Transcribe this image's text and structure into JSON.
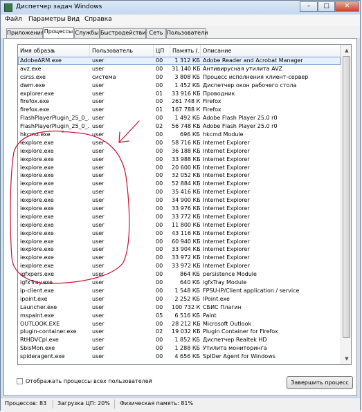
{
  "window": {
    "title": "Диспетчер задач Windows"
  },
  "window_controls": {
    "minimize": "–",
    "maximize": "□",
    "close": "✕"
  },
  "menu": [
    "Файл",
    "Параметры",
    "Вид",
    "Справка"
  ],
  "tabs": [
    "Приложения",
    "Процессы",
    "Службы",
    "Быстродействие",
    "Сеть",
    "Пользователи"
  ],
  "active_tab": "Процессы",
  "columns": [
    "Имя образа",
    "Пользователь",
    "ЦП",
    "Память (...",
    "Описание"
  ],
  "processes": [
    [
      "AdobeARM.exe",
      "user",
      "00",
      "1 312 КБ",
      "Adobe Reader and Acrobat Manager"
    ],
    [
      "avz.exe",
      "user",
      "00",
      "31 140 КБ",
      "Антивирусная утилита AVZ"
    ],
    [
      "csrss.exe",
      "система",
      "00",
      "3 808 КБ",
      "Процесс исполнения клиент-сервер"
    ],
    [
      "dwm.exe",
      "user",
      "00",
      "1 452 КБ",
      "Диспетчер окон рабочего стола"
    ],
    [
      "explorer.exe",
      "user",
      "01",
      "33 916 КБ",
      "Проводник"
    ],
    [
      "firefox.exe",
      "user",
      "00",
      "261 748 КБ",
      "Firefox"
    ],
    [
      "firefox.exe",
      "user",
      "01",
      "167 788 КБ",
      "Firefox"
    ],
    [
      "FlashPlayerPlugin_25_0_...",
      "user",
      "00",
      "1 492 КБ",
      "Adobe Flash Player 25.0 r0"
    ],
    [
      "FlashPlayerPlugin_25_0_...",
      "user",
      "02",
      "56 748 КБ",
      "Adobe Flash Player 25.0 r0"
    ],
    [
      "hkcmd.exe",
      "user",
      "00",
      "696 КБ",
      "hkcmd Module"
    ],
    [
      "iexplore.exe",
      "user",
      "00",
      "58 716 КБ",
      "Internet Explorer"
    ],
    [
      "iexplore.exe",
      "user",
      "00",
      "36 188 КБ",
      "Internet Explorer"
    ],
    [
      "iexplore.exe",
      "user",
      "00",
      "33 988 КБ",
      "Internet Explorer"
    ],
    [
      "iexplore.exe",
      "user",
      "00",
      "20 600 КБ",
      "Internet Explorer"
    ],
    [
      "iexplore.exe",
      "user",
      "00",
      "32 052 КБ",
      "Internet Explorer"
    ],
    [
      "iexplore.exe",
      "user",
      "00",
      "52 884 КБ",
      "Internet Explorer"
    ],
    [
      "iexplore.exe",
      "user",
      "00",
      "35 416 КБ",
      "Internet Explorer"
    ],
    [
      "iexplore.exe",
      "user",
      "00",
      "34 900 КБ",
      "Internet Explorer"
    ],
    [
      "iexplore.exe",
      "user",
      "00",
      "33 976 КБ",
      "Internet Explorer"
    ],
    [
      "iexplore.exe",
      "user",
      "00",
      "33 772 КБ",
      "Internet Explorer"
    ],
    [
      "iexplore.exe",
      "user",
      "00",
      "11 800 КБ",
      "Internet Explorer"
    ],
    [
      "iexplore.exe",
      "user",
      "00",
      "43 116 КБ",
      "Internet Explorer"
    ],
    [
      "iexplore.exe",
      "user",
      "00",
      "60 940 КБ",
      "Internet Explorer"
    ],
    [
      "iexplore.exe",
      "user",
      "00",
      "33 904 КБ",
      "Internet Explorer"
    ],
    [
      "iexplore.exe",
      "user",
      "00",
      "33 972 КБ",
      "Internet Explorer"
    ],
    [
      "iexplore.exe",
      "user",
      "00",
      "33 972 КБ",
      "Internet Explorer"
    ],
    [
      "igfxpers.exe",
      "user",
      "00",
      "864 КБ",
      "persistence Module"
    ],
    [
      "igfxTray.exe",
      "user",
      "00",
      "640 КБ",
      "igfxTray Module"
    ],
    [
      "ip-client.exe",
      "user",
      "00",
      "1 548 КБ",
      "FPSU-IP/Client application / service"
    ],
    [
      "ipoint.exe",
      "user",
      "00",
      "2 252 КБ",
      "IPoint.exe"
    ],
    [
      "Launcher.exe",
      "user",
      "00",
      "100 732 КБ",
      "СБИС Плагин"
    ],
    [
      "mspaint.exe",
      "user",
      "05",
      "6 516 КБ",
      "Paint"
    ],
    [
      "OUTLOOK.EXE",
      "user",
      "00",
      "28 212 КБ",
      "Microsoft Outlook"
    ],
    [
      "plugin-container.exe",
      "user",
      "02",
      "19 032 КБ",
      "Plugin Container for Firefox"
    ],
    [
      "RtHDVCpl.exe",
      "user",
      "00",
      "1 852 КБ",
      "Диспетчер Realtek HD"
    ],
    [
      "SbisMon.exe",
      "user",
      "00",
      "1 288 КБ",
      "Утилита мониторинга"
    ],
    [
      "spideragent.exe",
      "user",
      "00",
      "4 656 КБ",
      "SpIDer Agent for Windows"
    ]
  ],
  "show_all_label": "Отображать процессы всех пользователей",
  "end_process_label": "Завершить процесс",
  "status": {
    "processes": "Процессов: 83",
    "cpu": "Загрузка ЦП: 20%",
    "memory": "Физическая память: 81%"
  },
  "colors": {
    "annotation": "#c8102e",
    "selection": "#e6f0fa"
  }
}
